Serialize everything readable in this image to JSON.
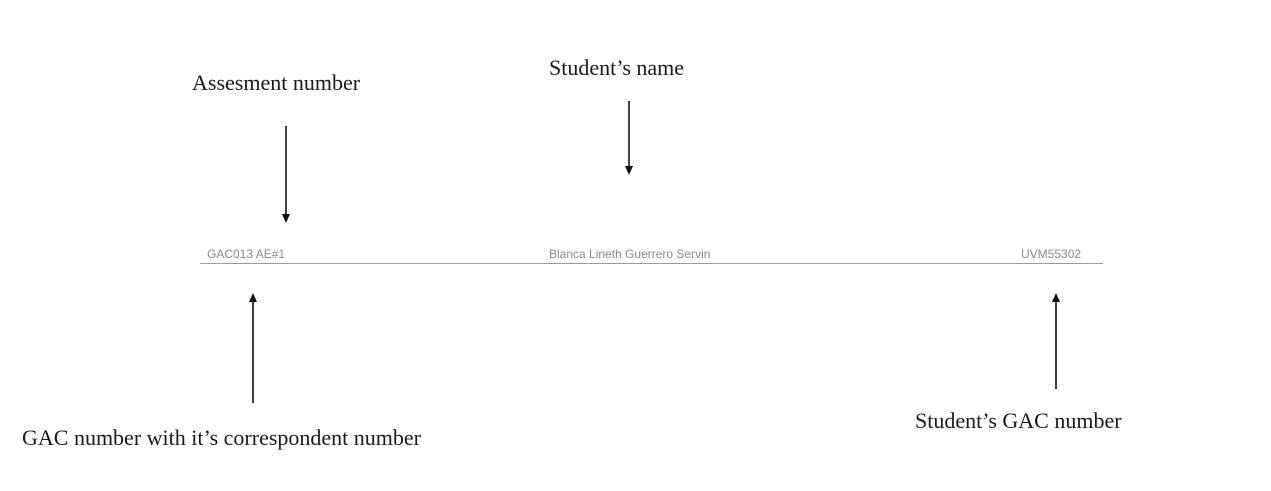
{
  "annotations": {
    "assessment_number": "Assesment number",
    "students_name": "Student’s name",
    "gac_with_number": "GAC number with it’s correspondent number",
    "students_gac_number": "Student’s GAC number"
  },
  "header": {
    "left_text": "GAC013 AE#1",
    "center_text": "Blanca Lineth Guerrero Servin",
    "right_text": "UVM55302"
  }
}
